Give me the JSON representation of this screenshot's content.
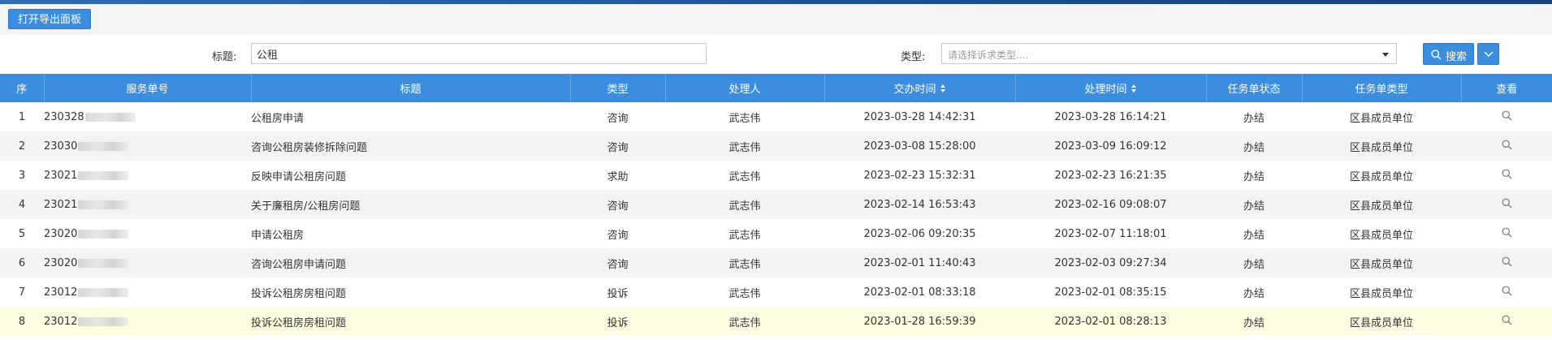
{
  "toolbar": {
    "export_label": "打开导出面板"
  },
  "filters": {
    "title_label": "标题:",
    "title_value": "公租",
    "type_label": "类型:",
    "type_placeholder": "请选择诉求类型....",
    "search_label": "搜索"
  },
  "table": {
    "headers": [
      "序",
      "服务单号",
      "标题",
      "类型",
      "处理人",
      "交办时间",
      "处理时间",
      "任务单状态",
      "任务单类型",
      "查看"
    ],
    "rows": [
      {
        "idx": "1",
        "id": "230328",
        "title": "公租房申请",
        "type": "咨询",
        "handler": "武志伟",
        "assigned": "2023-03-28 14:42:31",
        "handled": "2023-03-28 16:14:21",
        "status": "办结",
        "task_type": "区县成员单位"
      },
      {
        "idx": "2",
        "id": "23030",
        "title": "咨询公租房装修拆除问题",
        "type": "咨询",
        "handler": "武志伟",
        "assigned": "2023-03-08 15:28:00",
        "handled": "2023-03-09 16:09:12",
        "status": "办结",
        "task_type": "区县成员单位"
      },
      {
        "idx": "3",
        "id": "23021",
        "title": "反映申请公租房问题",
        "type": "求助",
        "handler": "武志伟",
        "assigned": "2023-02-23 15:32:31",
        "handled": "2023-02-23 16:21:35",
        "status": "办结",
        "task_type": "区县成员单位"
      },
      {
        "idx": "4",
        "id": "23021",
        "title": "关于廉租房/公租房问题",
        "type": "咨询",
        "handler": "武志伟",
        "assigned": "2023-02-14 16:53:43",
        "handled": "2023-02-16 09:08:07",
        "status": "办结",
        "task_type": "区县成员单位"
      },
      {
        "idx": "5",
        "id": "23020",
        "title": "申请公租房",
        "type": "咨询",
        "handler": "武志伟",
        "assigned": "2023-02-06 09:20:35",
        "handled": "2023-02-07 11:18:01",
        "status": "办结",
        "task_type": "区县成员单位"
      },
      {
        "idx": "6",
        "id": "23020",
        "title": "咨询公租房申请问题",
        "type": "咨询",
        "handler": "武志伟",
        "assigned": "2023-02-01 11:40:43",
        "handled": "2023-02-03 09:27:34",
        "status": "办结",
        "task_type": "区县成员单位"
      },
      {
        "idx": "7",
        "id": "23012",
        "title": "投诉公租房房租问题",
        "type": "投诉",
        "handler": "武志伟",
        "assigned": "2023-02-01 08:33:18",
        "handled": "2023-02-01 08:35:15",
        "status": "办结",
        "task_type": "区县成员单位"
      },
      {
        "idx": "8",
        "id": "23012",
        "title": "投诉公租房房租问题",
        "type": "投诉",
        "handler": "武志伟",
        "assigned": "2023-01-28 16:59:39",
        "handled": "2023-02-01 08:28:13",
        "status": "办结",
        "task_type": "区县成员单位"
      }
    ],
    "highlighted_row": 8
  },
  "icons": {
    "search": "search-icon",
    "dropdown": "chevron-down-icon",
    "view": "magnifier-icon"
  },
  "colors": {
    "primary": "#3b8de0",
    "highlight_row": "#fdfde1",
    "striped_row": "#f3f3f3"
  }
}
